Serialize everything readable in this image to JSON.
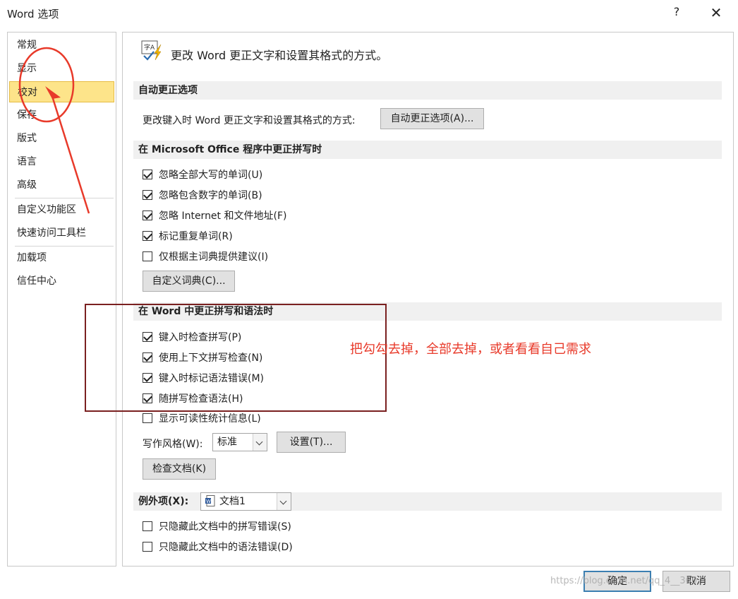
{
  "window": {
    "title": "Word 选项",
    "help": "?",
    "close": "✕"
  },
  "sidebar": {
    "items": [
      {
        "label": "常规"
      },
      {
        "label": "显示"
      },
      {
        "label": "校对",
        "selected": true
      },
      {
        "label": "保存"
      },
      {
        "label": "版式"
      },
      {
        "label": "语言"
      },
      {
        "label": "高级"
      },
      {
        "label": "自定义功能区"
      },
      {
        "label": "快速访问工具栏"
      },
      {
        "label": "加载项"
      },
      {
        "label": "信任中心"
      }
    ]
  },
  "main": {
    "header_icon": "proofing-icon",
    "header_text": "更改 Word 更正文字和设置其格式的方式。",
    "autocorrect": {
      "title": "自动更正选项",
      "label": "更改键入时 Word 更正文字和设置其格式的方式:",
      "button": "自动更正选项(A)..."
    },
    "office": {
      "title": "在 Microsoft Office 程序中更正拼写时",
      "options": [
        {
          "label": "忽略全部大写的单词(U)",
          "checked": true
        },
        {
          "label": "忽略包含数字的单词(B)",
          "checked": true
        },
        {
          "label": "忽略 Internet 和文件地址(F)",
          "checked": true
        },
        {
          "label": "标记重复单词(R)",
          "checked": true
        },
        {
          "label": "仅根据主词典提供建议(I)",
          "checked": false
        }
      ],
      "dict_button": "自定义词典(C)..."
    },
    "word": {
      "title": "在 Word 中更正拼写和语法时",
      "options": [
        {
          "label": "键入时检查拼写(P)",
          "checked": true
        },
        {
          "label": "使用上下文拼写检查(N)",
          "checked": true
        },
        {
          "label": "键入时标记语法错误(M)",
          "checked": true
        },
        {
          "label": "随拼写检查语法(H)",
          "checked": true
        },
        {
          "label": "显示可读性统计信息(L)",
          "checked": false
        }
      ],
      "style_label": "写作风格(W):",
      "style_value": "标准",
      "settings_button": "设置(T)...",
      "check_button": "检查文档(K)"
    },
    "exceptions": {
      "label": "例外项(X):",
      "doc_value": "文档1",
      "options": [
        {
          "label": "只隐藏此文档中的拼写错误(S)",
          "checked": false
        },
        {
          "label": "只隐藏此文档中的语法错误(D)",
          "checked": false
        }
      ]
    }
  },
  "footer": {
    "ok": "确定",
    "cancel": "取消"
  },
  "annotation": {
    "text": "把勾勾去掉，全部去掉，或者看看自己需求",
    "color": "#e83a2a"
  },
  "watermark": "https://blog.csdn.net/qq_4__360"
}
